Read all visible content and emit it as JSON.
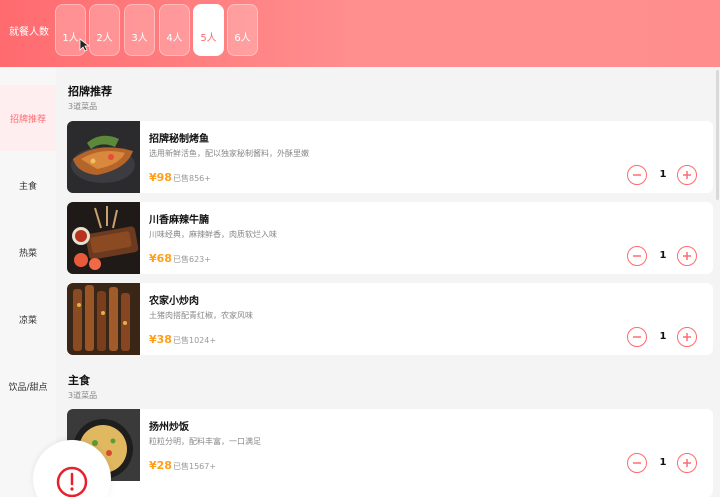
{
  "header": {
    "diner_label": "就餐人数",
    "party_sizes": [
      "1人",
      "2人",
      "3人",
      "4人",
      "5人",
      "6人"
    ],
    "selected": "5人"
  },
  "sidebar": {
    "items": [
      {
        "label": "招牌推荐",
        "active": true
      },
      {
        "label": "主食",
        "active": false
      },
      {
        "label": "热菜",
        "active": false
      },
      {
        "label": "凉菜",
        "active": false
      },
      {
        "label": "饮品/甜点",
        "active": false
      }
    ]
  },
  "sections": [
    {
      "title": "招牌推荐",
      "count": "3道菜品",
      "dishes": [
        {
          "name": "招牌秘制烤鱼",
          "desc": "选用新鲜活鱼，配以独家秘制酱料，外酥里嫩",
          "price": "¥98",
          "sold": "已售856+",
          "qty": "1"
        },
        {
          "name": "川香麻辣牛腩",
          "desc": "川味经典，麻辣鲜香，肉质软烂入味",
          "price": "¥68",
          "sold": "已售623+",
          "qty": "1"
        },
        {
          "name": "农家小炒肉",
          "desc": "土猪肉搭配青红椒，农家风味",
          "price": "¥38",
          "sold": "已售1024+",
          "qty": "1"
        }
      ]
    },
    {
      "title": "主食",
      "count": "3道菜品",
      "dishes": [
        {
          "name": "扬州炒饭",
          "desc": "粒粒分明，配料丰富，一口满足",
          "price": "¥28",
          "sold": "已售1567+",
          "qty": "1"
        }
      ]
    }
  ],
  "colors": {
    "accent": "#ff6b6f",
    "price": "#ff9f1a",
    "header_gradient_start": "#ff6b6f",
    "header_gradient_end": "#ff8d8d"
  },
  "icons": {
    "minus": "minus-circle-icon",
    "plus": "plus-circle-icon",
    "alert": "alert-circle-icon",
    "cursor": "mouse-pointer-icon"
  }
}
